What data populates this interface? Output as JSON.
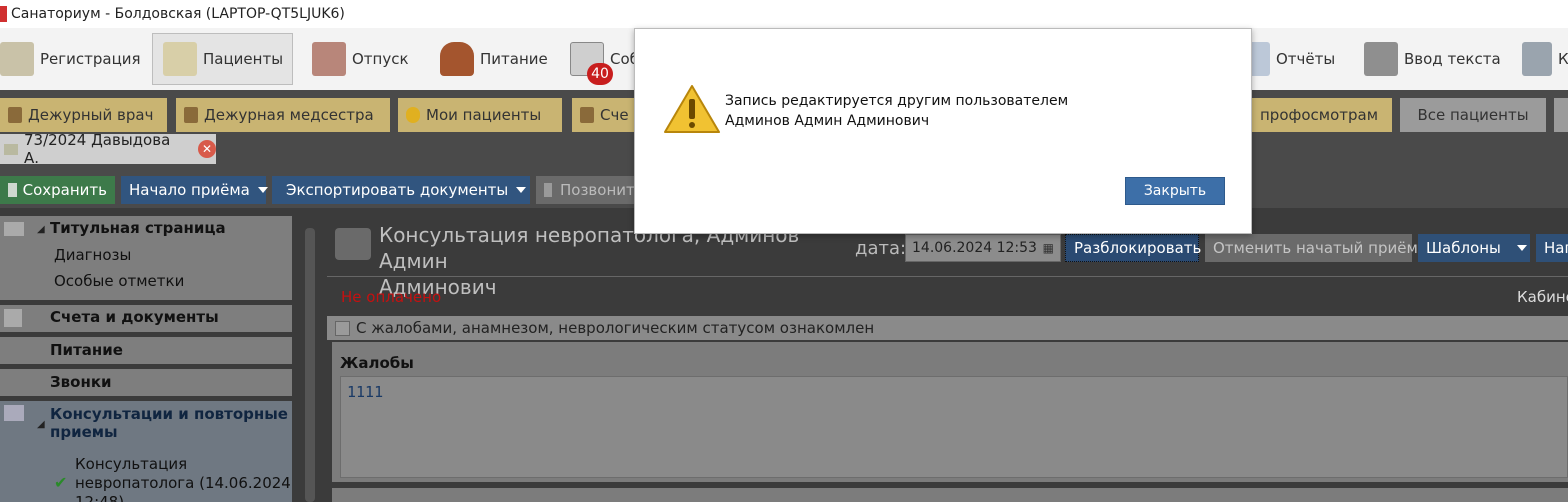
{
  "window": {
    "title": "Санаториум - Болдовская (LAPTOP-QT5LJUK6)"
  },
  "ribbon": {
    "items": [
      {
        "label": "Регистрация",
        "icon": "registration-icon"
      },
      {
        "label": "Пациенты",
        "icon": "patients-icon",
        "active": true
      },
      {
        "label": "Отпуск",
        "icon": "vacation-icon"
      },
      {
        "label": "Питание",
        "icon": "cake-icon"
      },
      {
        "label": "Соб",
        "icon": "calendar-icon",
        "badge": "40"
      },
      {
        "label": "Отчёты",
        "icon": "reports-icon"
      },
      {
        "label": "Ввод текста",
        "icon": "typewriter-icon"
      },
      {
        "label": "К",
        "icon": "clipboard-icon"
      }
    ]
  },
  "shortcuts": [
    {
      "label": "Дежурный врач"
    },
    {
      "label": "Дежурная медсестра"
    },
    {
      "label": "Мои пациенты"
    },
    {
      "label": "Сче"
    },
    {
      "label": "профосмотрам"
    },
    {
      "label": "Все пациенты"
    }
  ],
  "doc_tab": {
    "label": "73/2024 Давыдова А.",
    "close": "✕"
  },
  "toolbar": {
    "save": "Сохранить",
    "start": "Начало приёма",
    "export": "Экспортировать документы",
    "call": "Позвонит"
  },
  "sidebar": {
    "title_page": "Титульная страница",
    "diagnoses": "Диагнозы",
    "special_marks": "Особые отметки",
    "bills": "Счета и документы",
    "food": "Питание",
    "calls": "Звонки",
    "consult_line1": "Консультации и повторные",
    "consult_line2": "приемы",
    "item_line1": "Консультация",
    "item_line2": "невропатолога (14.06.2024",
    "item_line3": "12:48)"
  },
  "content": {
    "title_line1": "Консультация невропатолога, Админов Админ",
    "title_line2": "Админович",
    "date_label": "дата:",
    "date_value": "14.06.2024 12:53",
    "unlock": "Разблокировать",
    "cancel_started": "Отменить начатый приём",
    "templates": "Шаблоны",
    "more": "Наг",
    "not_paid": "Не оплачено",
    "cabinet": "Кабине",
    "acknowledged": "С жалобами, анамнезом, неврологическим статусом ознакомлен",
    "complaints_label": "Жалобы",
    "complaints_value": "1111"
  },
  "dialog": {
    "line1": "Запись редактируется другим пользователем",
    "line2": "Админов Админ Админович",
    "close": "Закрыть"
  },
  "colors": {
    "accent_blue": "#3d6fa8",
    "save_green": "#3d7a4a",
    "not_paid_red": "#c51010",
    "shortcut_gold": "#c9b472"
  }
}
